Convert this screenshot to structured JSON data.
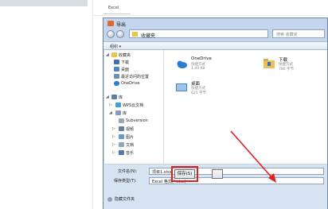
{
  "background": {
    "excel_label": "Excel"
  },
  "dialog": {
    "title": "导出",
    "address_segment": "收藏夹",
    "search_placeholder": "搜索 收藏夹",
    "organize_label": "组织 ▾",
    "nav_tree": [
      {
        "label": "收藏夹",
        "icon": "star-icon"
      },
      {
        "label": "下载",
        "icon": "download-folder-icon"
      },
      {
        "label": "桌面",
        "icon": "desktop-icon"
      },
      {
        "label": "最近访问的位置",
        "icon": "recent-icon"
      },
      {
        "label": "OneDrive",
        "icon": "cloud-icon"
      },
      {
        "label": "库",
        "icon": "library-icon"
      },
      {
        "label": "WPS云文档",
        "icon": "cloud-doc-icon"
      },
      {
        "label": "库",
        "icon": "library-icon"
      },
      {
        "label": "Subversion",
        "icon": "folder-icon"
      },
      {
        "label": "视频",
        "icon": "video-icon"
      },
      {
        "label": "图片",
        "icon": "picture-icon"
      },
      {
        "label": "文档",
        "icon": "document-icon"
      },
      {
        "label": "音乐",
        "icon": "music-icon"
      }
    ],
    "files": [
      {
        "name": "OneDrive",
        "type": "快捷方式",
        "size": "1.49 KB",
        "icon": "cloud-icon"
      },
      {
        "name": "下载",
        "type": "快捷方式",
        "size": "786 字节",
        "icon": "folder-icon"
      },
      {
        "name": "桌面",
        "type": "快捷方式",
        "size": "625 字节",
        "icon": "desktop-icon"
      }
    ],
    "filename_label": "文件名(N):",
    "filename_value": "项目1.xlsx",
    "filetype_label": "保存类型(T):",
    "filetype_value": "Excel 格式(*.xlsx)",
    "hide_folders_label": "隐藏文件夹",
    "save_label": "保存(S)"
  },
  "colors": {
    "annotation_red": "#e02020",
    "dialog_frame": "#c3d6ec"
  }
}
